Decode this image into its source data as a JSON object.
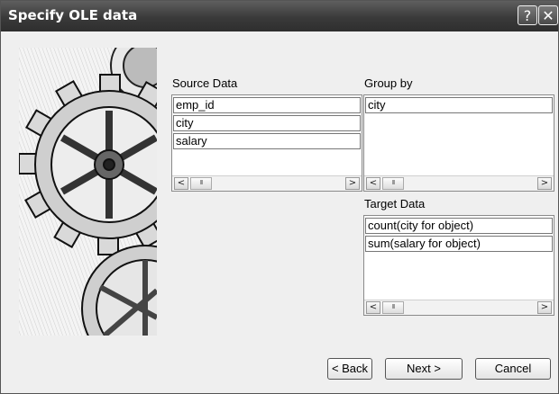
{
  "window": {
    "title": "Specify OLE data",
    "help_label": "?",
    "close_label": "✕"
  },
  "source": {
    "label": "Source Data",
    "items": [
      "emp_id",
      "city",
      "salary"
    ]
  },
  "groupby": {
    "label": "Group by",
    "items": [
      "city"
    ]
  },
  "target": {
    "label": "Target Data",
    "items": [
      "count(city for object)",
      "sum(salary for object)"
    ]
  },
  "scrollbar": {
    "left_glyph": "<",
    "right_glyph": ">",
    "thumb_glyph": "III"
  },
  "buttons": {
    "back": "< Back",
    "next": "Next >",
    "cancel": "Cancel"
  }
}
